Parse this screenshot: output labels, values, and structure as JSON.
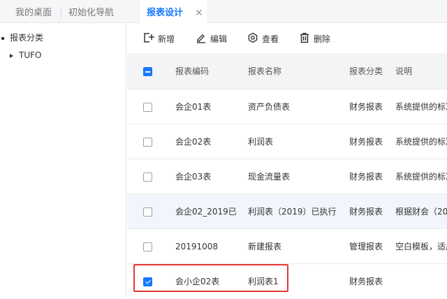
{
  "tabs": [
    {
      "label": "我的桌面"
    },
    {
      "label": "初始化导航"
    },
    {
      "label": "报表设计",
      "active": true
    }
  ],
  "tab_close_glyph": "✕",
  "tree": {
    "root": "报表分类",
    "children": [
      "TUFO"
    ]
  },
  "toolbar": {
    "add_label": "新增",
    "edit_label": "编辑",
    "view_label": "查看",
    "delete_label": "删除"
  },
  "table": {
    "columns": [
      "报表编码",
      "报表名称",
      "报表分类",
      "说明"
    ],
    "header_checkbox": "indeterminate",
    "rows": [
      {
        "code": "会企01表",
        "name": "资产负债表",
        "category": "财务报表",
        "desc": "系统提供的标准",
        "checked": false
      },
      {
        "code": "会企02表",
        "name": "利润表",
        "category": "财务报表",
        "desc": "系统提供的标准",
        "checked": false
      },
      {
        "code": "会企03表",
        "name": "现金流量表",
        "category": "财务报表",
        "desc": "系统提供的标准",
        "checked": false
      },
      {
        "code": "会企02_2019已",
        "name": "利润表（2019）已执行",
        "category": "财务报表",
        "desc": "根据财会（2019",
        "checked": false,
        "highlighted": true
      },
      {
        "code": "20191008",
        "name": "新建报表",
        "category": "管理报表",
        "desc": "空白模板，适用",
        "checked": false
      },
      {
        "code": "会小企02表",
        "name": "利润表1",
        "category": "财务报表",
        "desc": "",
        "checked": true
      }
    ]
  },
  "colors": {
    "accent": "#1677ff",
    "selection_outline": "#e53935"
  }
}
